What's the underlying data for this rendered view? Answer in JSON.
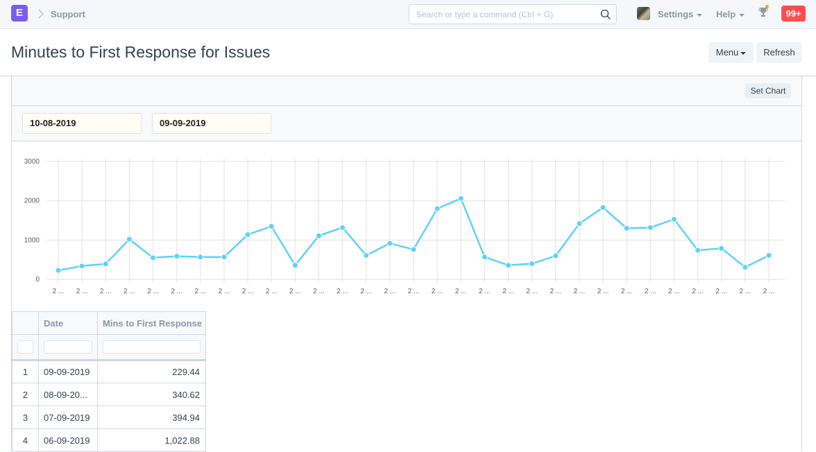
{
  "navbar": {
    "logo_letter": "E",
    "breadcrumb": "Support",
    "search_placeholder": "Search or type a command (Ctrl + G)",
    "settings_label": "Settings",
    "help_label": "Help",
    "notification_badge": "99+",
    "colors": {
      "logo": "#7b5cf5",
      "badge": "#ff4d4f",
      "trophy_dot": "#f5a623"
    }
  },
  "page": {
    "title": "Minutes to First Response for Issues",
    "menu_label": "Menu",
    "refresh_label": "Refresh",
    "set_chart_label": "Set Chart"
  },
  "filters": {
    "from_date": "10-08-2019",
    "to_date": "09-09-2019"
  },
  "chart_data": {
    "type": "line",
    "title": "",
    "xlabel": "",
    "ylabel": "",
    "ylim": [
      0,
      3000
    ],
    "yticks": [
      0,
      1000,
      2000,
      3000
    ],
    "grid": true,
    "legend": "none",
    "line_color": "#5ed2f7",
    "x": [
      "2 ...",
      "2 ...",
      "2 ...",
      "2 ...",
      "2 ...",
      "2 ...",
      "2 ...",
      "2 ...",
      "2 ...",
      "2 ...",
      "2 ...",
      "2 ...",
      "2 ...",
      "2 ...",
      "2 ...",
      "2 ...",
      "2 ...",
      "2 ...",
      "2 ...",
      "2 ...",
      "2 ...",
      "2 ...",
      "2 ...",
      "2 ...",
      "2 ...",
      "2 ...",
      "2 ...",
      "2 ...",
      "2 ...",
      "2 ...",
      "2 ..."
    ],
    "series": [
      {
        "name": "Mins to First Response",
        "values": [
          229.44,
          340.62,
          394.94,
          1022.88,
          550,
          590,
          570,
          570,
          1140,
          1350,
          360,
          1110,
          1320,
          610,
          920,
          760,
          1800,
          2060,
          570,
          360,
          400,
          600,
          1420,
          1830,
          1300,
          1320,
          1530,
          740,
          790,
          310,
          610
        ]
      }
    ]
  },
  "table": {
    "columns": [
      "",
      "Date",
      "Mins to First Response"
    ],
    "rows": [
      {
        "index": "1",
        "date": "09-09-2019",
        "value": "229.44"
      },
      {
        "index": "2",
        "date": "08-09-20...",
        "value": "340.62"
      },
      {
        "index": "3",
        "date": "07-09-2019",
        "value": "394.94"
      },
      {
        "index": "4",
        "date": "06-09-2019",
        "value": "1,022.88"
      }
    ]
  }
}
